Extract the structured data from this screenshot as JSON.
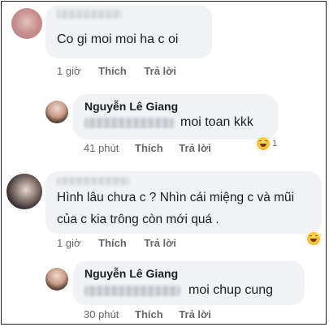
{
  "comments": [
    {
      "text": "Co gi moi moi ha c oi",
      "time": "1 giờ",
      "like": "Thích",
      "reply": "Trả lời"
    },
    {
      "author": "Nguyễn Lê Giang",
      "text": "moi toan kkk",
      "time": "41 phút",
      "like": "Thích",
      "reply": "Trả lời",
      "reaction_count": "1"
    },
    {
      "author": "Minh Tuyền Phan",
      "text_line1": "Hình lâu chưa c ? Nhìn cái miệng c và mũi",
      "text_line2": "của c kia trông còn mới quá .",
      "time": "1 giờ",
      "like": "Thích",
      "reply": "Trả lời"
    },
    {
      "author": "Nguyễn Lê Giang",
      "mention": "Minh Tuyền Phan",
      "text": "moi chup cung",
      "time": "30 phút",
      "like": "Thích",
      "reply": "Trả lời"
    }
  ],
  "colors": {
    "bubble": "#f0f2f5",
    "meta_text": "#65676b",
    "main_text": "#1c1e21",
    "reaction": "#f7b928"
  },
  "icons": [
    "laugh-reaction-icon"
  ]
}
